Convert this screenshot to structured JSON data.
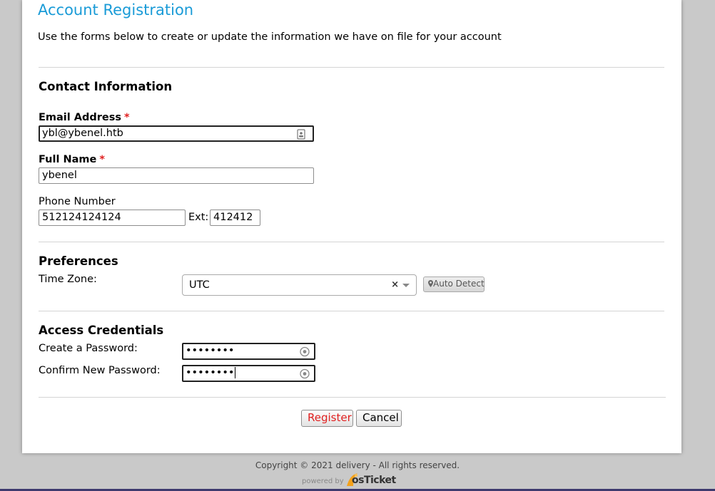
{
  "page": {
    "title": "Account Registration",
    "intro": "Use the forms below to create or update the information we have on file for your account"
  },
  "contact": {
    "heading": "Contact Information",
    "email_label": "Email Address",
    "email_value": "ybl@ybenel.htb",
    "fullname_label": "Full Name",
    "fullname_value": "ybenel",
    "phone_label": "Phone Number",
    "phone_value": "512124124124",
    "ext_label": "Ext:",
    "ext_value": "412412",
    "required_mark": "*"
  },
  "preferences": {
    "heading": "Preferences",
    "timezone_label": "Time Zone:",
    "timezone_value": "UTC",
    "clear_symbol": "×",
    "auto_detect_label": "Auto Detect"
  },
  "credentials": {
    "heading": "Access Credentials",
    "password_label": "Create a Password:",
    "password_value": "••••••••",
    "confirm_label": "Confirm New Password:",
    "confirm_value": "••••••••"
  },
  "actions": {
    "register_label": "Register",
    "cancel_label": "Cancel"
  },
  "footer": {
    "copyright": "Copyright © 2021 delivery - All rights reserved.",
    "powered_by": "powered by",
    "brand": "osTicket"
  },
  "colors": {
    "title": "#1a9bd7",
    "required": "#e02020",
    "register_text": "#e02020",
    "background": "#c9c9c9"
  },
  "icons": {
    "email_field": "contact-card-icon",
    "password_field": "password-reveal-icon",
    "auto_detect": "map-pin-icon",
    "timezone_dropdown": "chevron-down-icon"
  }
}
